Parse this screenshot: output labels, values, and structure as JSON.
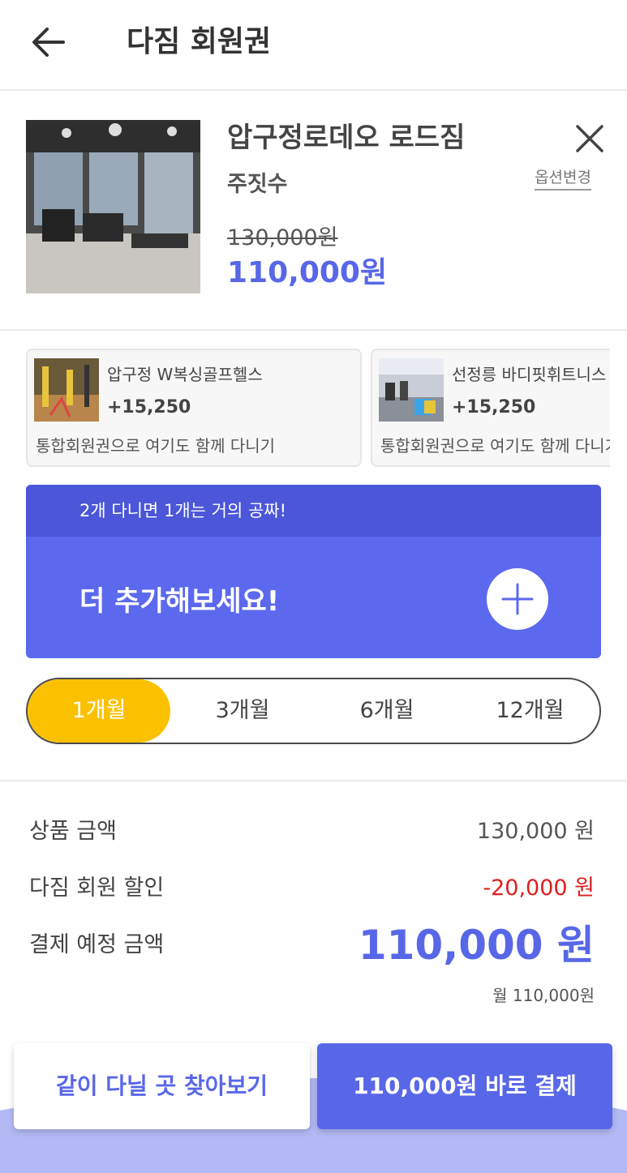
{
  "header": {
    "title": "다짐 회원권",
    "back_icon": "arrow-left-icon"
  },
  "product": {
    "name": "압구정로데오 로드짐",
    "area": "주짓수",
    "option_change": "옵션변경",
    "original_price": "130,000원",
    "sale_price": "110,000원",
    "close_icon": "close-icon"
  },
  "suggestions": [
    {
      "name": "압구정 W복싱골프헬스",
      "price": "+15,250",
      "desc": "통합회원권으로 여기도 함께 다니기"
    },
    {
      "name": "선정릉 바디핏휘트니스",
      "price": "+15,250",
      "desc": "통합회원권으로 여기도 함께 다니기"
    }
  ],
  "add_banner": {
    "subtitle": "2개 다니면 1개는 거의 공짜!",
    "title": "더 추가해보세요!",
    "icon": "plus-icon"
  },
  "periods": [
    {
      "label": "1개월",
      "active": true
    },
    {
      "label": "3개월",
      "active": false
    },
    {
      "label": "6개월",
      "active": false
    },
    {
      "label": "12개월",
      "active": false
    }
  ],
  "summary": {
    "product_label": "상품 금액",
    "product_value": "130,000 원",
    "discount_label": "다짐 회원 할인",
    "discount_value": "-20,000 원",
    "total_label": "결제 예정 금액",
    "total_value": "110,000 원",
    "monthly": "월 110,000원"
  },
  "buttons": {
    "find": "같이 다닐 곳 찾아보기",
    "pay": "110,000원 바로 결제"
  },
  "colors": {
    "accent": "#5867e8",
    "banner": "#5c69ee",
    "banner_top": "#4b56d8",
    "active_period": "#fbc100",
    "discount": "#dd1f1f"
  }
}
